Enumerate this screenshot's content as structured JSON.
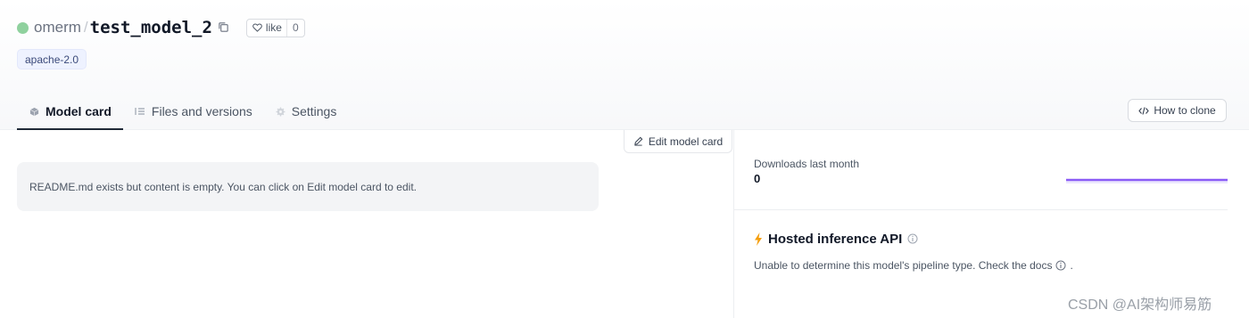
{
  "header": {
    "owner": "omerm",
    "separator": "/",
    "repo_name": "test_model_2",
    "like_label": "like",
    "like_count": "0",
    "license_tag": "apache-2.0",
    "status_color": "#8fd19e"
  },
  "tabs": [
    {
      "label": "Model card",
      "icon": "cube-icon",
      "active": true
    },
    {
      "label": "Files and versions",
      "icon": "files-icon",
      "active": false
    },
    {
      "label": "Settings",
      "icon": "gear-icon",
      "active": false
    }
  ],
  "actions": {
    "clone_label": "How to clone",
    "edit_label": "Edit model card"
  },
  "readme": {
    "message": "README.md exists but content is empty. You can click on Edit model card to edit."
  },
  "downloads": {
    "label": "Downloads last month",
    "value": "0",
    "sparkline_color": "#8b5cf6"
  },
  "inference": {
    "title": "Hosted inference API",
    "message": "Unable to determine this model's pipeline type. Check the docs",
    "suffix": "."
  },
  "watermark": "CSDN @AI架构师易筋"
}
